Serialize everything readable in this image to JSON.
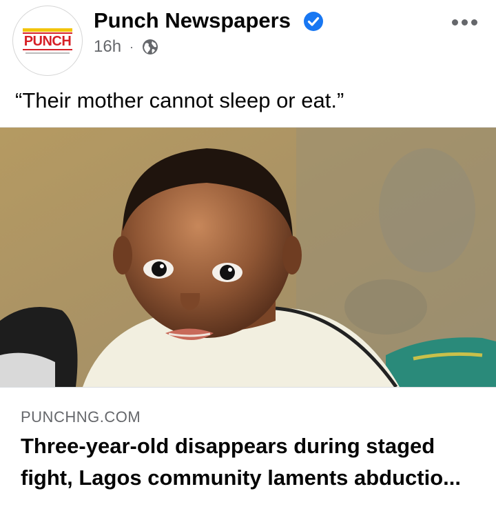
{
  "post": {
    "page_name": "Punch Newspapers",
    "time": "16h",
    "separator": "·",
    "caption": "“Their mother cannot sleep or eat.”",
    "logo_text": "PUNCH"
  },
  "link": {
    "domain": "PUNCHNG.COM",
    "headline_line1": "Three-year-old disappears during staged",
    "headline_line2": "fight, Lagos community laments abductio..."
  },
  "icons": {
    "verified": "verified-badge-icon",
    "audience": "globe-icon",
    "more": "more-options-icon"
  },
  "colors": {
    "verified_blue": "#1877f2",
    "secondary_text": "#65676b",
    "logo_red": "#d61f26",
    "logo_yellow": "#f2c40c"
  }
}
